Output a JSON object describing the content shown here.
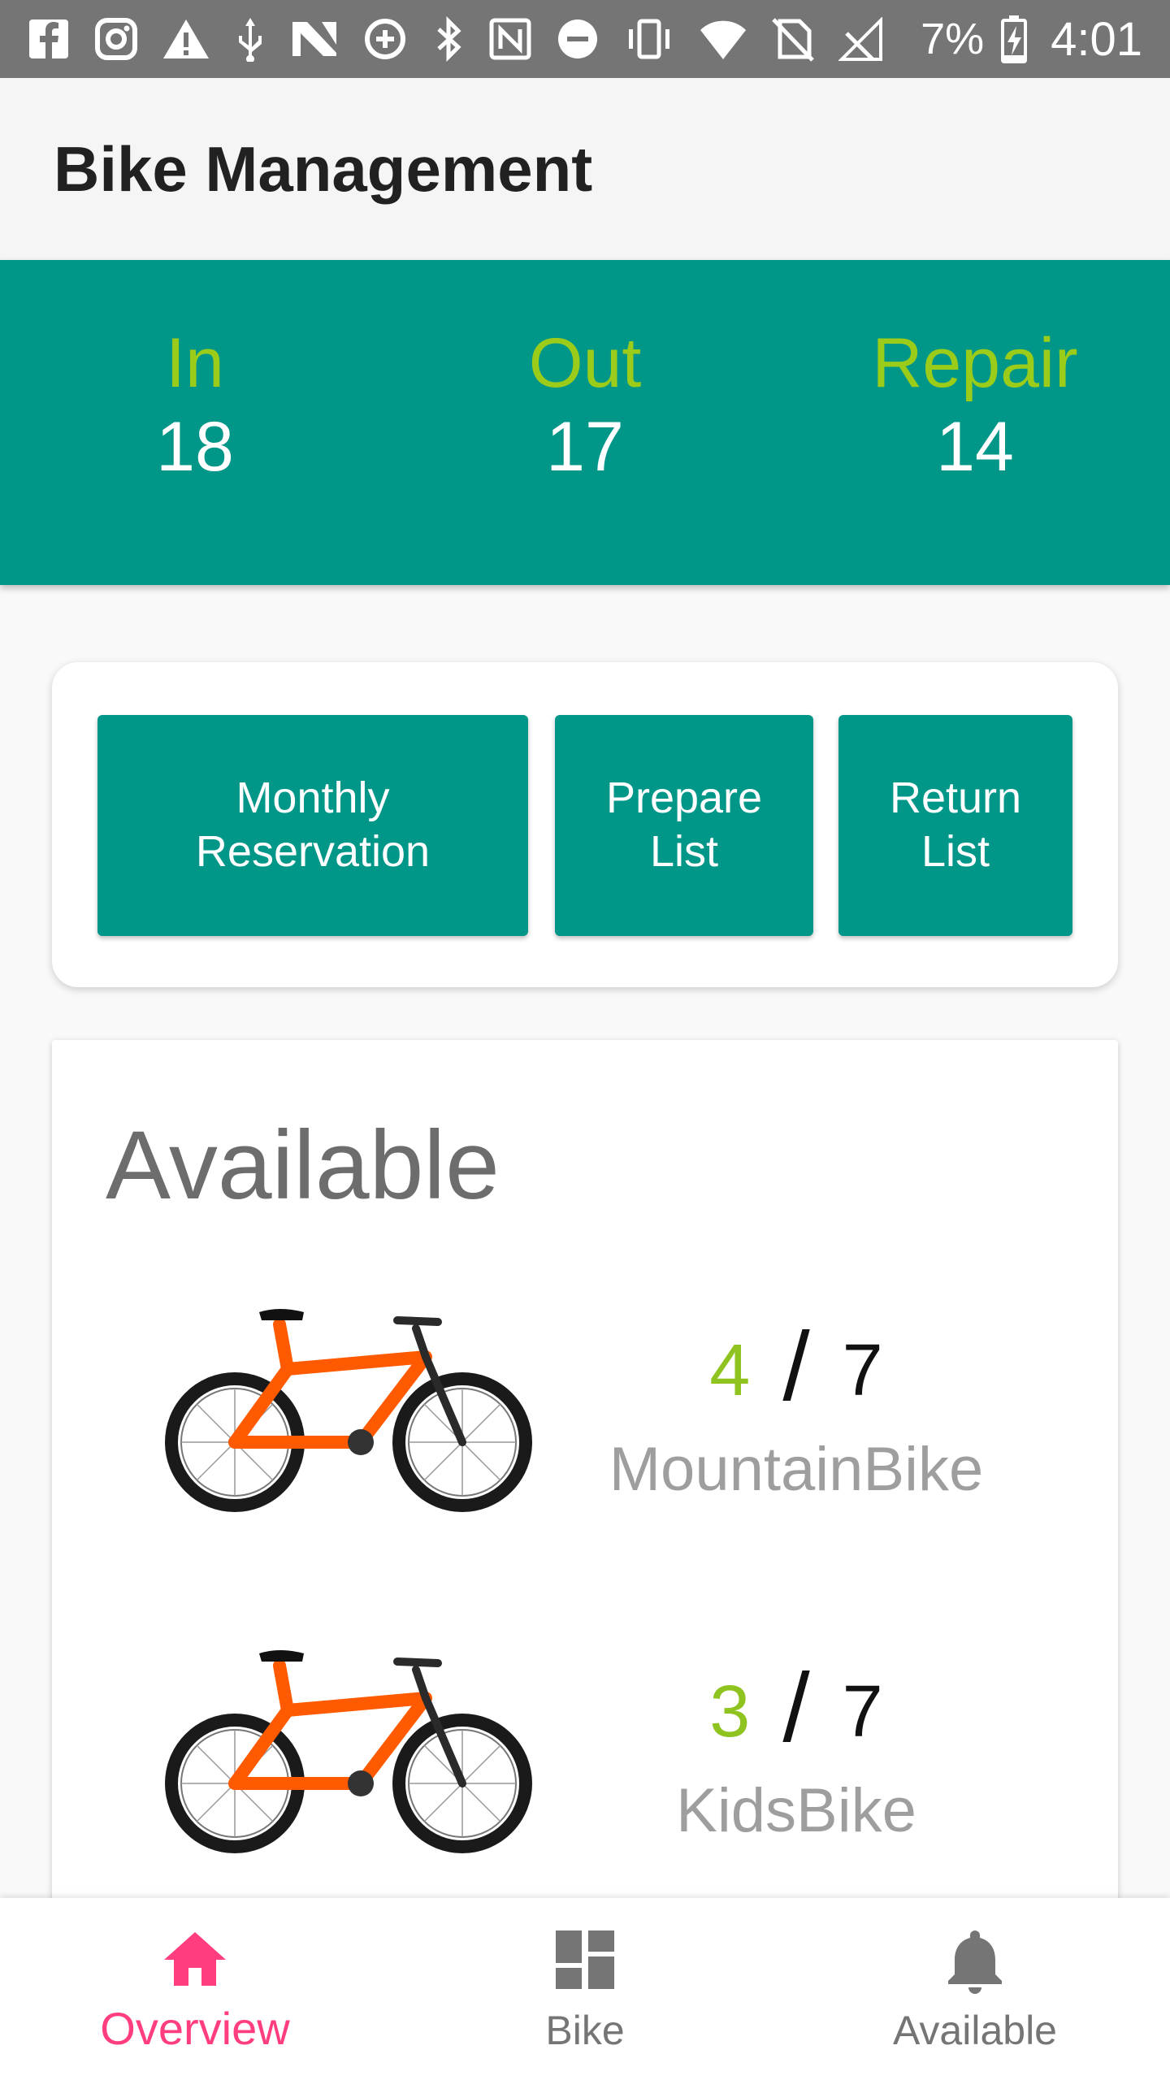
{
  "status_bar": {
    "battery": "7%",
    "time": "4:01",
    "icons": [
      "facebook-icon",
      "instagram-icon",
      "warning-icon",
      "usb-icon",
      "n-icon",
      "data-saver-icon",
      "bluetooth-icon",
      "nfc-icon",
      "dnd-icon",
      "vibrate-icon",
      "wifi-icon",
      "no-sim-icon",
      "no-signal-icon",
      "battery-charging-icon"
    ]
  },
  "app_bar": {
    "title": "Bike Management"
  },
  "stats": [
    {
      "label": "In",
      "value": "18"
    },
    {
      "label": "Out",
      "value": "17"
    },
    {
      "label": "Repair",
      "value": "14"
    }
  ],
  "actions": {
    "monthly_reservation": {
      "line1": "Monthly",
      "line2": "Reservation"
    },
    "prepare_list": {
      "line1": "Prepare",
      "line2": "List"
    },
    "return_list": {
      "line1": "Return",
      "line2": "List"
    }
  },
  "available": {
    "title": "Available",
    "bikes": [
      {
        "available": "4",
        "separator": "/",
        "total": "7",
        "name": "MountainBike",
        "image": "orange-mountain-bike"
      },
      {
        "available": "3",
        "separator": "/",
        "total": "7",
        "name": "KidsBike",
        "image": "orange-mountain-bike"
      }
    ]
  },
  "bottom_nav": {
    "items": [
      {
        "label": "Overview",
        "icon": "home-icon",
        "active": true
      },
      {
        "label": "Bike",
        "icon": "dashboard-icon",
        "active": false
      },
      {
        "label": "Available",
        "icon": "bell-icon",
        "active": false
      }
    ]
  },
  "colors": {
    "primary": "#009688",
    "accent_green": "#9ccc1a",
    "active_pink": "#ff3d7f",
    "status_bar": "#757575"
  }
}
